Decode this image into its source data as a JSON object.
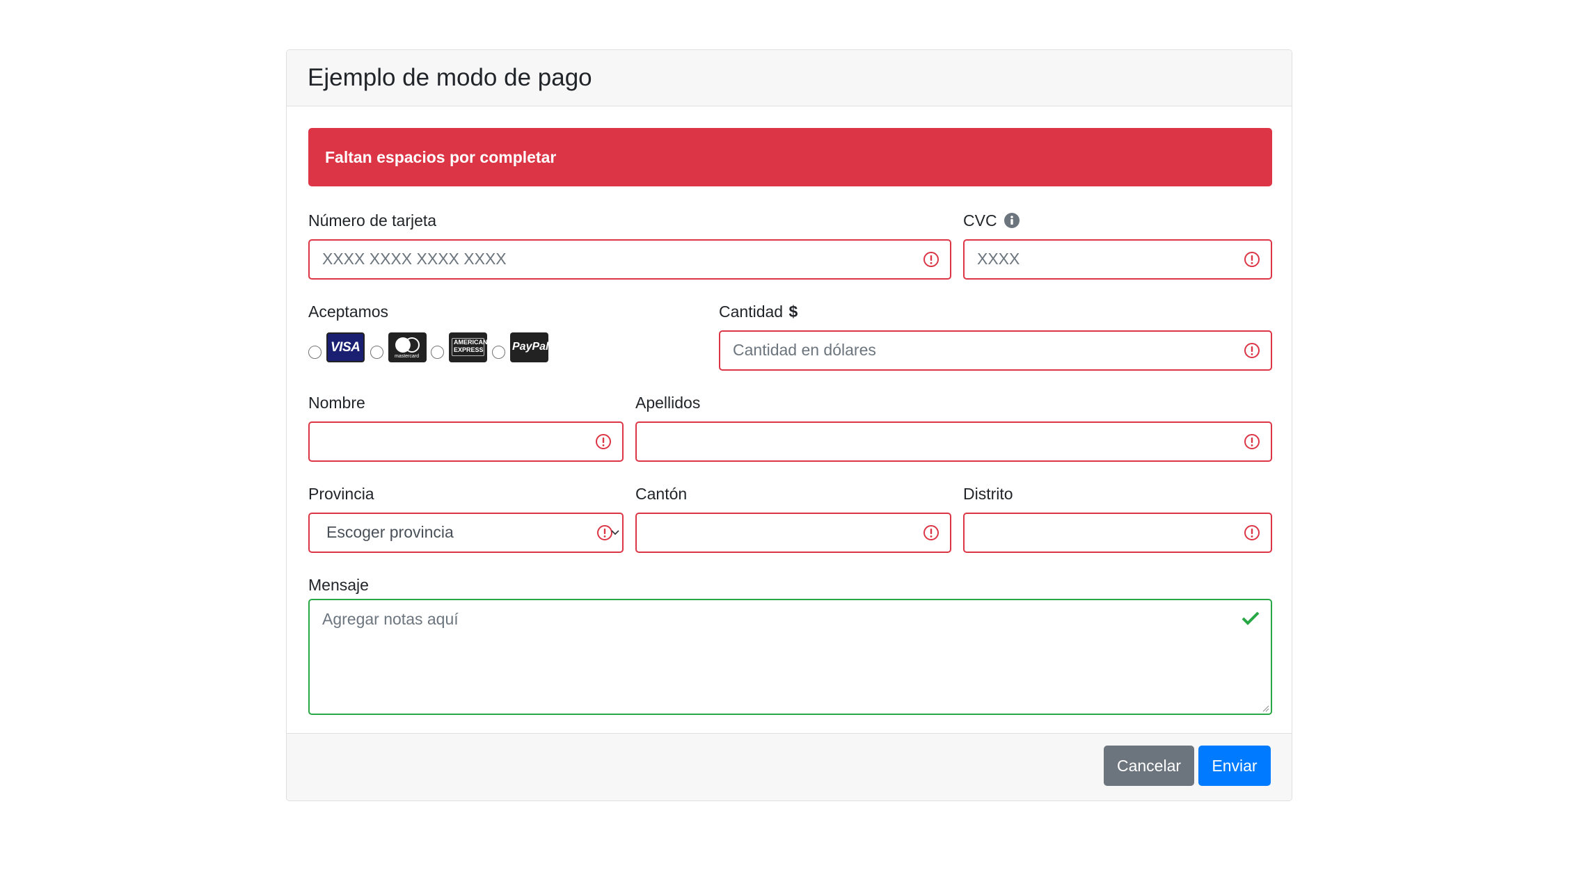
{
  "card": {
    "title": "Ejemplo de modo de pago"
  },
  "alert": {
    "text": "Faltan espacios por completar"
  },
  "card_number": {
    "label": "Número de tarjeta",
    "placeholder": "XXXX XXXX XXXX XXXX",
    "value": ""
  },
  "cvc": {
    "label": "CVC",
    "placeholder": "XXXX",
    "value": "",
    "info_icon": "info-circle-icon"
  },
  "accepted": {
    "label": "Aceptamos",
    "options": [
      {
        "name": "visa",
        "text": "VISA"
      },
      {
        "name": "mastercard",
        "text": "mastercard"
      },
      {
        "name": "amex",
        "text": "AMERICAN EXPRESS"
      },
      {
        "name": "paypal",
        "text": "PayPal"
      }
    ]
  },
  "amount": {
    "label": "Cantidad",
    "icon": "dollar-icon",
    "placeholder": "Cantidad en dólares",
    "value": ""
  },
  "first_name": {
    "label": "Nombre",
    "value": ""
  },
  "last_name": {
    "label": "Apellidos",
    "value": ""
  },
  "province": {
    "label": "Provincia",
    "selected": "Escoger provincia"
  },
  "canton": {
    "label": "Cantón",
    "value": ""
  },
  "district": {
    "label": "Distrito",
    "value": ""
  },
  "message": {
    "label": "Mensaje",
    "placeholder": "Agregar notas aquí",
    "value": ""
  },
  "footer": {
    "cancel_label": "Cancelar",
    "send_label": "Enviar"
  },
  "colors": {
    "error": "#dc3545",
    "success": "#28a745",
    "primary": "#007bff",
    "secondary": "#6c757d"
  }
}
